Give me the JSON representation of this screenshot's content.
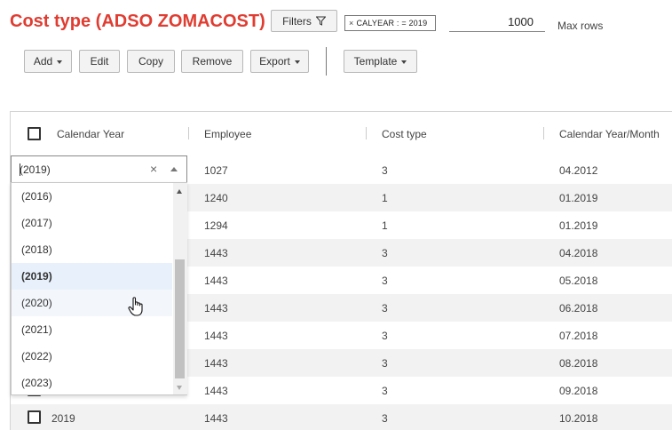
{
  "header": {
    "title": "Cost type (ADSO ZOMACOST)",
    "filters_label": "Filters",
    "filter_chip": "CALYEAR : = 2019",
    "max_rows_value": "1000",
    "max_rows_label": "Max rows"
  },
  "toolbar": {
    "add": "Add",
    "edit": "Edit",
    "copy": "Copy",
    "remove": "Remove",
    "export": "Export",
    "template": "Template"
  },
  "columns": [
    "Calendar Year",
    "Employee",
    "Cost type",
    "Calendar Year/Month"
  ],
  "rows": [
    {
      "year": "",
      "employee": "1027",
      "cost_type": "3",
      "month": "04.2012"
    },
    {
      "year": "",
      "employee": "1240",
      "cost_type": "1",
      "month": "01.2019"
    },
    {
      "year": "",
      "employee": "1294",
      "cost_type": "1",
      "month": "01.2019"
    },
    {
      "year": "",
      "employee": "1443",
      "cost_type": "3",
      "month": "04.2018"
    },
    {
      "year": "",
      "employee": "1443",
      "cost_type": "3",
      "month": "05.2018"
    },
    {
      "year": "",
      "employee": "1443",
      "cost_type": "3",
      "month": "06.2018"
    },
    {
      "year": "",
      "employee": "1443",
      "cost_type": "3",
      "month": "07.2018"
    },
    {
      "year": "",
      "employee": "1443",
      "cost_type": "3",
      "month": "08.2018"
    },
    {
      "year": "",
      "employee": "1443",
      "cost_type": "3",
      "month": "09.2018"
    },
    {
      "year": "2019",
      "employee": "1443",
      "cost_type": "3",
      "month": "10.2018"
    }
  ],
  "combo": {
    "value": "(2019)",
    "options": [
      "(2016)",
      "(2017)",
      "(2018)",
      "(2019)",
      "(2020)",
      "(2021)",
      "(2022)",
      "(2023)"
    ],
    "selected": "(2019)",
    "hovered": "(2020)"
  },
  "colors": {
    "title": "#e03c31",
    "row_alt": "#f2f2f2",
    "selected_option": "#e8f1fb"
  }
}
